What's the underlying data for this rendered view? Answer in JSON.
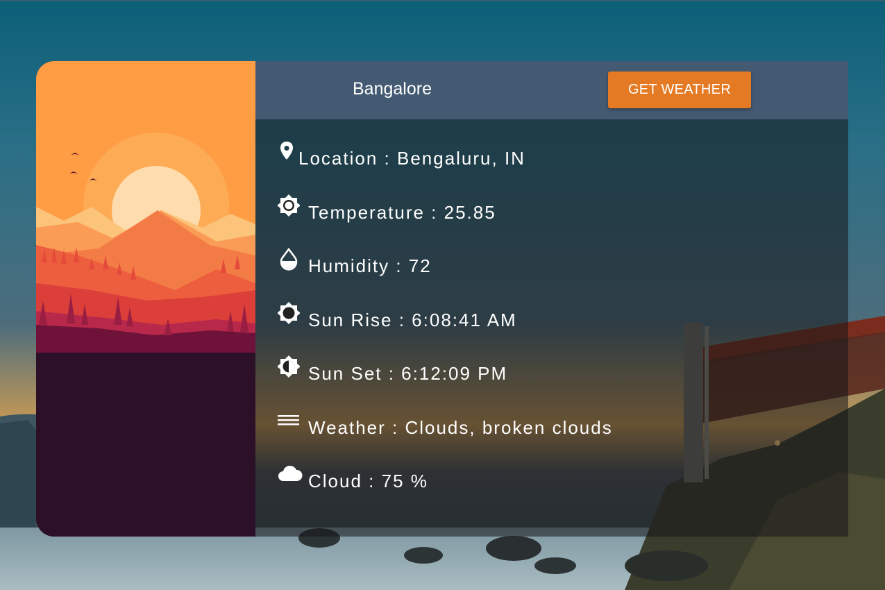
{
  "header": {
    "city_value": "Bangalore",
    "button_label": "GET WEATHER"
  },
  "info": [
    {
      "icon": "map-pin-icon",
      "text": "Location : Bengaluru, IN"
    },
    {
      "icon": "sun-icon",
      "text": "Temperature : 25.85"
    },
    {
      "icon": "water-drop-icon",
      "text": "Humidity : 72"
    },
    {
      "icon": "sunrise-icon",
      "text": "Sun Rise : 6:08:41 AM"
    },
    {
      "icon": "sunset-icon",
      "text": "Sun Set : 6:12:09 PM"
    },
    {
      "icon": "menu-lines-icon",
      "text": "Weather : Clouds, broken clouds"
    },
    {
      "icon": "cloud-icon",
      "text": "Cloud : 75 %"
    }
  ],
  "colors": {
    "accent": "#e47b24",
    "header": "#445a72",
    "left_panel_sky": "#fe9d44",
    "left_panel_ground": "#2b1028"
  }
}
